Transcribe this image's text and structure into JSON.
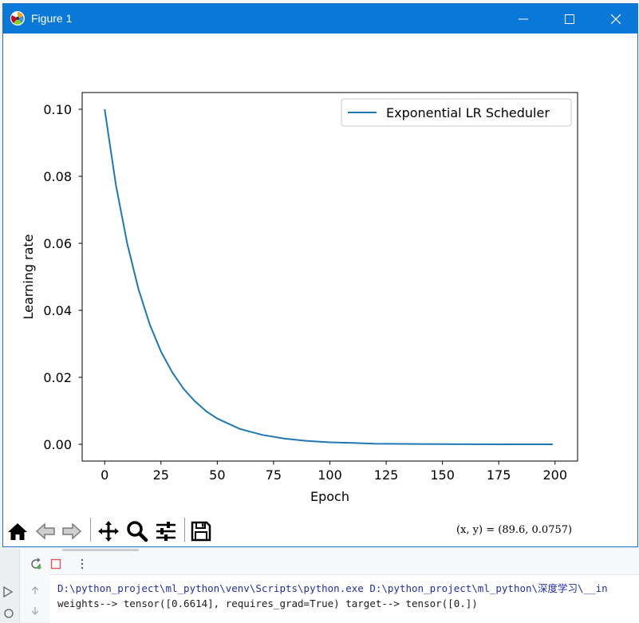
{
  "window": {
    "title": "Figure 1",
    "accent": "#0a78d7",
    "controls": [
      "minimize-icon",
      "maximize-icon",
      "close-icon"
    ]
  },
  "chart_data": {
    "type": "line",
    "xlabel": "Epoch",
    "ylabel": "Learning rate",
    "xlim": [
      -10,
      210
    ],
    "ylim": [
      -0.005,
      0.105
    ],
    "x_ticks": [
      0,
      25,
      50,
      75,
      100,
      125,
      150,
      175,
      200
    ],
    "x_tick_labels": [
      "0",
      "25",
      "50",
      "75",
      "100",
      "125",
      "150",
      "175",
      "200"
    ],
    "y_ticks": [
      0.0,
      0.02,
      0.04,
      0.06,
      0.08,
      0.1
    ],
    "y_tick_labels": [
      "0.00",
      "0.02",
      "0.04",
      "0.06",
      "0.08",
      "0.10"
    ],
    "legend_position": "upper right",
    "grid": false,
    "series": [
      {
        "name": "Exponential LR Scheduler",
        "color": "#1f77b4",
        "x": [
          0,
          5,
          10,
          15,
          20,
          25,
          30,
          35,
          40,
          45,
          50,
          60,
          70,
          80,
          90,
          100,
          110,
          120,
          140,
          160,
          180,
          199
        ],
        "y": [
          0.1,
          0.0774,
          0.0599,
          0.0463,
          0.0358,
          0.0277,
          0.0215,
          0.0166,
          0.0129,
          0.0099,
          0.0077,
          0.0046,
          0.0028,
          0.0017,
          0.001,
          0.0006,
          0.0004,
          0.0002,
          0.0001,
          3e-05,
          1e-05,
          0.0
        ]
      }
    ]
  },
  "toolbar": {
    "buttons": [
      "home-icon",
      "back-icon",
      "forward-icon",
      "pan-icon",
      "zoom-icon",
      "configure-subplots-icon",
      "save-icon"
    ],
    "coords_text": "(x, y) = (89.6, 0.0757)"
  },
  "console": {
    "command_line": "D:\\python_project\\ml_python\\venv\\Scripts\\python.exe D:\\python_project\\ml_python\\深度学习\\__in",
    "output_line": "weights--> tensor([0.6614], requires_grad=True) target--> tensor([0.])"
  }
}
